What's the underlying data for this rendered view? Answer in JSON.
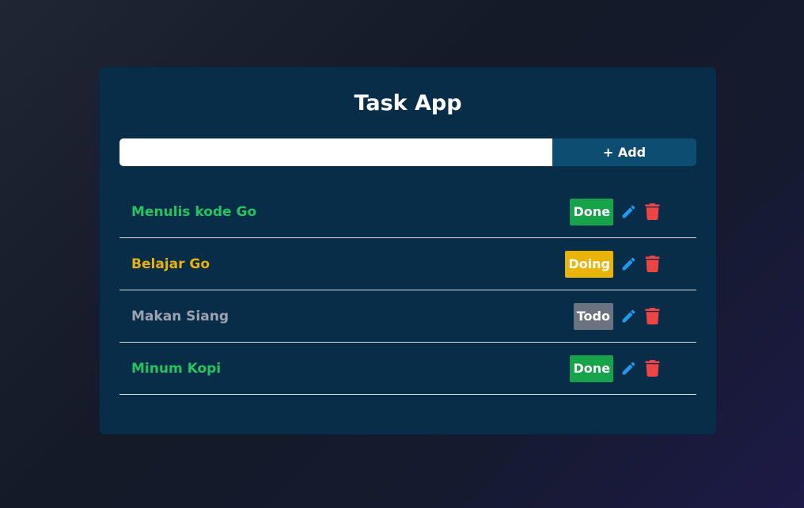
{
  "app": {
    "title": "Task App"
  },
  "add_form": {
    "input_value": "",
    "input_placeholder": "",
    "add_label": "+ Add"
  },
  "colors": {
    "done": "#16a34a",
    "doing": "#eab308",
    "todo": "#6b7280",
    "done_text": "#22c55e",
    "doing_text": "#eab308",
    "todo_text": "#9ca3af",
    "edit_icon": "#1d9bf0",
    "delete_icon": "#ef4444"
  },
  "tasks": [
    {
      "name": "Menulis kode Go",
      "status": "Done",
      "status_key": "done",
      "edit_icon": "pencil-icon",
      "delete_icon": "trash-icon"
    },
    {
      "name": "Belajar Go",
      "status": "Doing",
      "status_key": "doing",
      "edit_icon": "pencil-icon",
      "delete_icon": "trash-icon"
    },
    {
      "name": "Makan Siang",
      "status": "Todo",
      "status_key": "todo",
      "edit_icon": "pencil-icon",
      "delete_icon": "trash-icon"
    },
    {
      "name": "Minum Kopi",
      "status": "Done",
      "status_key": "done",
      "edit_icon": "pencil-icon",
      "delete_icon": "trash-icon"
    }
  ]
}
